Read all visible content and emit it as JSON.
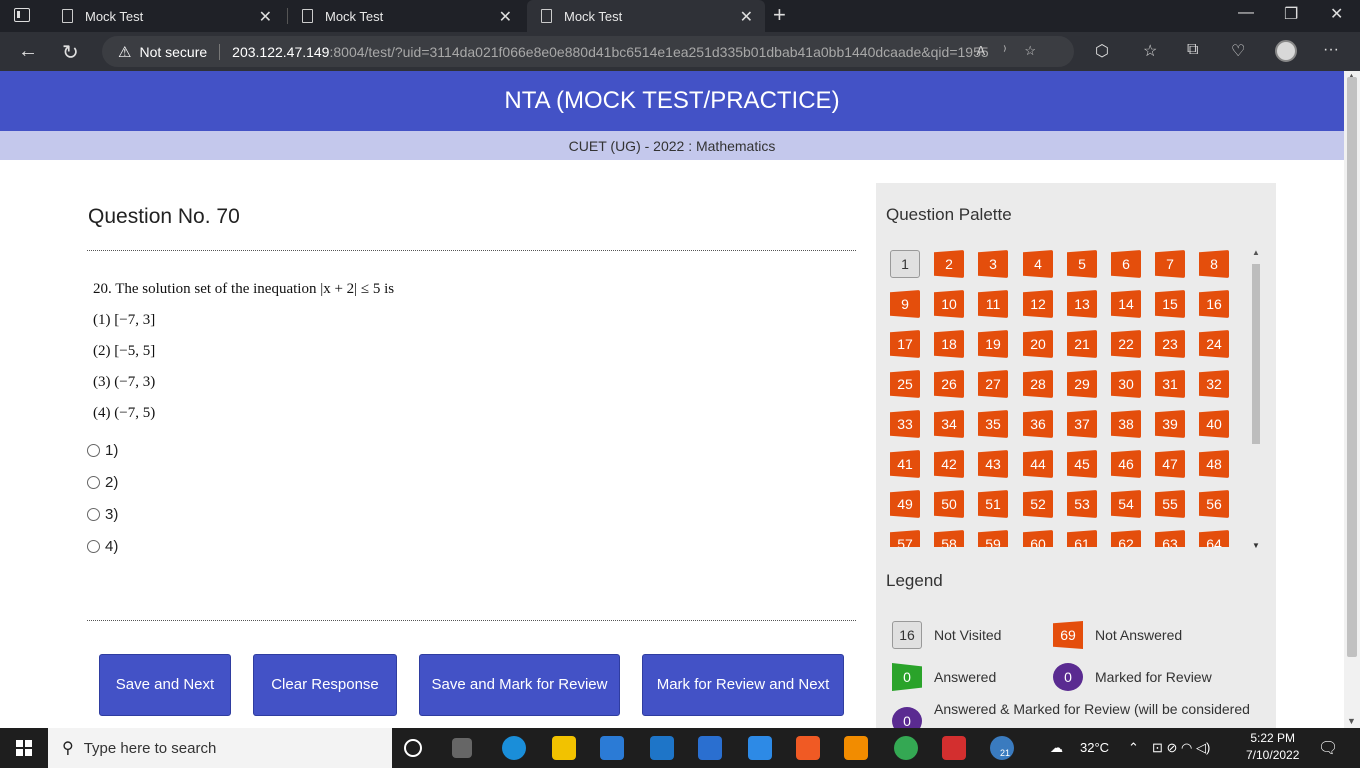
{
  "browser": {
    "tabs": [
      {
        "title": "Mock Test"
      },
      {
        "title": "Mock Test"
      },
      {
        "title": "Mock Test",
        "active": true
      }
    ],
    "security_label": "Not secure",
    "url_host": "203.122.47.149",
    "url_rest": ":8004/test/?uid=3114da021f066e8e0e880d41bc6514e1ea251d335b01dbab41a0bb1440dcaade&qid=1955"
  },
  "header": {
    "title": "NTA (MOCK TEST/PRACTICE)",
    "subtitle": "CUET (UG) - 2022 : Mathematics"
  },
  "question": {
    "title": "Question No. 70",
    "text": "20. The solution set of the inequation |x + 2| ≤ 5 is",
    "choices": [
      "(1) [−7,  3]",
      "(2) [−5,  5]",
      "(3) (−7,  3)",
      "(4) (−7,  5)"
    ],
    "options": [
      "1)",
      "2)",
      "3)",
      "4)"
    ]
  },
  "buttons": {
    "save_next": "Save and Next",
    "clear": "Clear Response",
    "save_mark": "Save and Mark for Review",
    "mark_next": "Mark for Review and Next"
  },
  "palette": {
    "title": "Question Palette",
    "items": [
      {
        "n": "1",
        "state": "not-visited"
      },
      {
        "n": "2",
        "state": "not-answered"
      },
      {
        "n": "3",
        "state": "not-answered"
      },
      {
        "n": "4",
        "state": "not-answered"
      },
      {
        "n": "5",
        "state": "not-answered"
      },
      {
        "n": "6",
        "state": "not-answered"
      },
      {
        "n": "7",
        "state": "not-answered"
      },
      {
        "n": "8",
        "state": "not-answered"
      },
      {
        "n": "9",
        "state": "not-answered"
      },
      {
        "n": "10",
        "state": "not-answered"
      },
      {
        "n": "11",
        "state": "not-answered"
      },
      {
        "n": "12",
        "state": "not-answered"
      },
      {
        "n": "13",
        "state": "not-answered"
      },
      {
        "n": "14",
        "state": "not-answered"
      },
      {
        "n": "15",
        "state": "not-answered"
      },
      {
        "n": "16",
        "state": "not-answered"
      },
      {
        "n": "17",
        "state": "not-answered"
      },
      {
        "n": "18",
        "state": "not-answered"
      },
      {
        "n": "19",
        "state": "not-answered"
      },
      {
        "n": "20",
        "state": "not-answered"
      },
      {
        "n": "21",
        "state": "not-answered"
      },
      {
        "n": "22",
        "state": "not-answered"
      },
      {
        "n": "23",
        "state": "not-answered"
      },
      {
        "n": "24",
        "state": "not-answered"
      },
      {
        "n": "25",
        "state": "not-answered"
      },
      {
        "n": "26",
        "state": "not-answered"
      },
      {
        "n": "27",
        "state": "not-answered"
      },
      {
        "n": "28",
        "state": "not-answered"
      },
      {
        "n": "29",
        "state": "not-answered"
      },
      {
        "n": "30",
        "state": "not-answered"
      },
      {
        "n": "31",
        "state": "not-answered"
      },
      {
        "n": "32",
        "state": "not-answered"
      },
      {
        "n": "33",
        "state": "not-answered"
      },
      {
        "n": "34",
        "state": "not-answered"
      },
      {
        "n": "35",
        "state": "not-answered"
      },
      {
        "n": "36",
        "state": "not-answered"
      },
      {
        "n": "37",
        "state": "not-answered"
      },
      {
        "n": "38",
        "state": "not-answered"
      },
      {
        "n": "39",
        "state": "not-answered"
      },
      {
        "n": "40",
        "state": "not-answered"
      },
      {
        "n": "41",
        "state": "not-answered"
      },
      {
        "n": "42",
        "state": "not-answered"
      },
      {
        "n": "43",
        "state": "not-answered"
      },
      {
        "n": "44",
        "state": "not-answered"
      },
      {
        "n": "45",
        "state": "not-answered"
      },
      {
        "n": "46",
        "state": "not-answered"
      },
      {
        "n": "47",
        "state": "not-answered"
      },
      {
        "n": "48",
        "state": "not-answered"
      },
      {
        "n": "49",
        "state": "not-answered"
      },
      {
        "n": "50",
        "state": "not-answered"
      },
      {
        "n": "51",
        "state": "not-answered"
      },
      {
        "n": "52",
        "state": "not-answered"
      },
      {
        "n": "53",
        "state": "not-answered"
      },
      {
        "n": "54",
        "state": "not-answered"
      },
      {
        "n": "55",
        "state": "not-answered"
      },
      {
        "n": "56",
        "state": "not-answered"
      },
      {
        "n": "57",
        "state": "not-answered"
      },
      {
        "n": "58",
        "state": "not-answered"
      },
      {
        "n": "59",
        "state": "not-answered"
      },
      {
        "n": "60",
        "state": "not-answered"
      },
      {
        "n": "61",
        "state": "not-answered"
      },
      {
        "n": "62",
        "state": "not-answered"
      },
      {
        "n": "63",
        "state": "not-answered"
      },
      {
        "n": "64",
        "state": "not-answered"
      }
    ]
  },
  "legend": {
    "title": "Legend",
    "not_visited": {
      "count": "16",
      "label": "Not Visited"
    },
    "not_answered": {
      "count": "69",
      "label": "Not Answered"
    },
    "answered": {
      "count": "0",
      "label": "Answered"
    },
    "marked": {
      "count": "0",
      "label": "Marked for Review"
    },
    "answered_marked": {
      "count": "0",
      "label": "Answered & Marked for Review (will be considered"
    }
  },
  "taskbar": {
    "search_placeholder": "Type here to search",
    "weather": "32°C",
    "time": "5:22 PM",
    "date": "7/10/2022",
    "badge": "21"
  },
  "colors": {
    "header_blue": "#4352c6",
    "not_answered_orange": "#e44e0c",
    "answered_green": "#2aa32a",
    "marked_purple": "#5a2b91"
  }
}
